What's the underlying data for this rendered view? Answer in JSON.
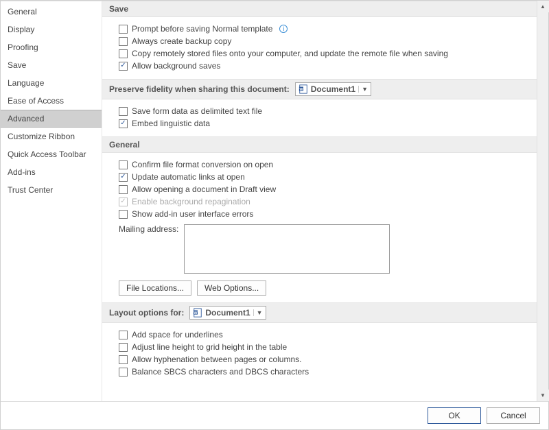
{
  "sidebar": {
    "items": [
      {
        "label": "General"
      },
      {
        "label": "Display"
      },
      {
        "label": "Proofing"
      },
      {
        "label": "Save"
      },
      {
        "label": "Language"
      },
      {
        "label": "Ease of Access"
      },
      {
        "label": "Advanced",
        "selected": true
      },
      {
        "label": "Customize Ribbon"
      },
      {
        "label": "Quick Access Toolbar"
      },
      {
        "label": "Add-ins"
      },
      {
        "label": "Trust Center"
      }
    ]
  },
  "sections": {
    "save": {
      "title": "Save",
      "opts": {
        "prompt_before": "Prompt before saving Normal template",
        "always_backup": "Always create backup copy",
        "copy_remote": "Copy remotely stored files onto your computer, and update the remote file when saving",
        "allow_bg": "Allow background saves"
      }
    },
    "preserve": {
      "title": "Preserve fidelity when sharing this document:",
      "dropdown": "Document1",
      "opts": {
        "save_form": "Save form data as delimited text file",
        "embed_ling": "Embed linguistic data"
      }
    },
    "general": {
      "title": "General",
      "opts": {
        "confirm_conv": "Confirm file format conversion on open",
        "update_links": "Update automatic links at open",
        "allow_draft": "Allow opening a document in Draft view",
        "enable_repag": "Enable background repagination",
        "show_addin": "Show add-in user interface errors",
        "mailing_label": "Mailing address:"
      },
      "buttons": {
        "file_loc": "File Locations...",
        "web_opt": "Web Options..."
      }
    },
    "layout": {
      "title": "Layout options for:",
      "dropdown": "Document1",
      "opts": {
        "add_space": "Add space for underlines",
        "adjust_line": "Adjust line height to grid height in the table",
        "allow_hyph": "Allow hyphenation between pages or columns.",
        "balance": "Balance SBCS characters and DBCS characters"
      }
    }
  },
  "footer": {
    "ok": "OK",
    "cancel": "Cancel"
  }
}
